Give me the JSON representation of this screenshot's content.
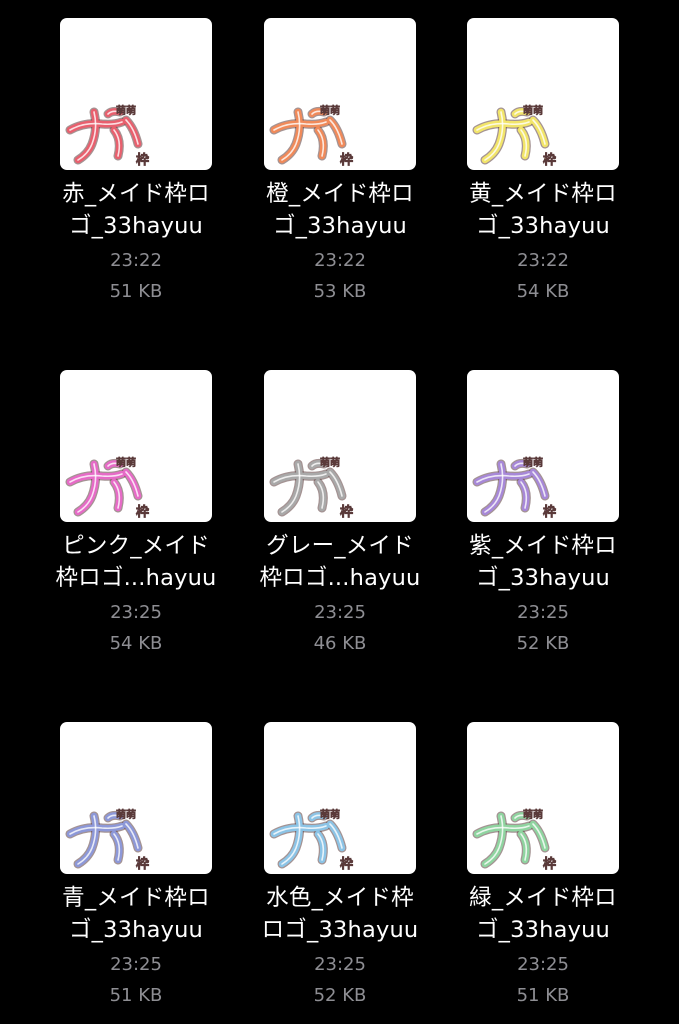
{
  "files": [
    {
      "name_line1": "赤_メイド枠ロ",
      "name_line2": "ゴ_33hayuu",
      "time": "23:22",
      "size": "51 KB",
      "color": "#e8606e",
      "logo_text": "ナ"
    },
    {
      "name_line1": "橙_メイド枠ロ",
      "name_line2": "ゴ_33hayuu",
      "time": "23:22",
      "size": "53 KB",
      "color": "#f08a5a",
      "logo_text": "ナ"
    },
    {
      "name_line1": "黄_メイド枠ロ",
      "name_line2": "ゴ_33hayuu",
      "time": "23:22",
      "size": "54 KB",
      "color": "#f2e56a",
      "logo_text": "ナ"
    },
    {
      "name_line1": "ピンク_メイド",
      "name_line2": "枠ロゴ...hayuu",
      "time": "23:25",
      "size": "54 KB",
      "color": "#e66bc7",
      "logo_text": "ナ"
    },
    {
      "name_line1": "グレー_メイド",
      "name_line2": "枠ロゴ...hayuu",
      "time": "23:25",
      "size": "46 KB",
      "color": "#a9a9a9",
      "logo_text": "ナ"
    },
    {
      "name_line1": "紫_メイド枠ロ",
      "name_line2": "ゴ_33hayuu",
      "time": "23:25",
      "size": "52 KB",
      "color": "#a788d8",
      "logo_text": "ナ"
    },
    {
      "name_line1": "青_メイド枠ロ",
      "name_line2": "ゴ_33hayuu",
      "time": "23:25",
      "size": "51 KB",
      "color": "#8d98d8",
      "logo_text": "ナ"
    },
    {
      "name_line1": "水色_メイド枠",
      "name_line2": "ロゴ_33hayuu",
      "time": "23:25",
      "size": "52 KB",
      "color": "#8cc4e6",
      "logo_text": "ナ"
    },
    {
      "name_line1": "緑_メイド枠ロ",
      "name_line2": "ゴ_33hayuu",
      "time": "23:25",
      "size": "51 KB",
      "color": "#8fd4a0",
      "logo_text": "ナ"
    }
  ]
}
